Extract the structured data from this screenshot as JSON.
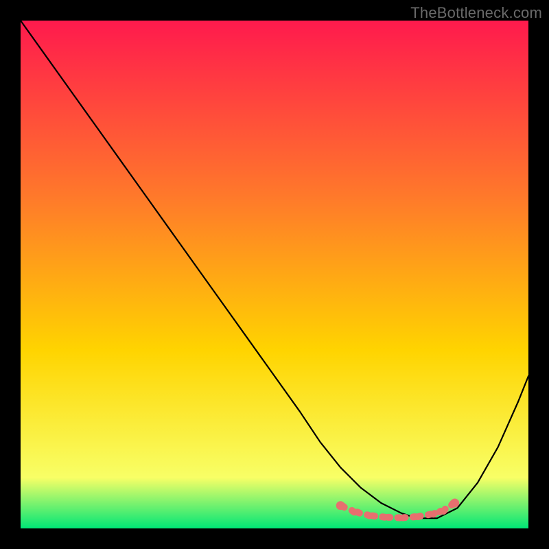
{
  "watermark": "TheBottleneck.com",
  "colors": {
    "background_frame": "#000000",
    "gradient_top": "#ff1a4d",
    "gradient_mid1": "#ff7a2a",
    "gradient_mid2": "#ffd400",
    "gradient_mid3": "#f8ff66",
    "gradient_bottom": "#00e676",
    "curve": "#000000",
    "marker": "#e76f6f"
  },
  "chart_data": {
    "type": "line",
    "title": "",
    "xlabel": "",
    "ylabel": "",
    "xlim": [
      0,
      100
    ],
    "ylim": [
      0,
      100
    ],
    "series": [
      {
        "name": "bottleneck-curve",
        "x": [
          0,
          5,
          10,
          15,
          20,
          25,
          30,
          35,
          40,
          45,
          50,
          55,
          59,
          63,
          67,
          71,
          75,
          78,
          82,
          86,
          90,
          94,
          98,
          100
        ],
        "y": [
          100,
          93,
          86,
          79,
          72,
          65,
          58,
          51,
          44,
          37,
          30,
          23,
          17,
          12,
          8,
          5,
          3,
          2,
          2,
          4,
          9,
          16,
          25,
          30
        ]
      }
    ],
    "markers": {
      "name": "bottom-markers",
      "points": [
        {
          "x": 63,
          "y": 4.5
        },
        {
          "x": 66,
          "y": 3.2
        },
        {
          "x": 69,
          "y": 2.5
        },
        {
          "x": 72,
          "y": 2.2
        },
        {
          "x": 75,
          "y": 2.1
        },
        {
          "x": 78,
          "y": 2.3
        },
        {
          "x": 81,
          "y": 2.8
        },
        {
          "x": 83,
          "y": 3.4
        },
        {
          "x": 85.5,
          "y": 5.0
        }
      ]
    }
  }
}
